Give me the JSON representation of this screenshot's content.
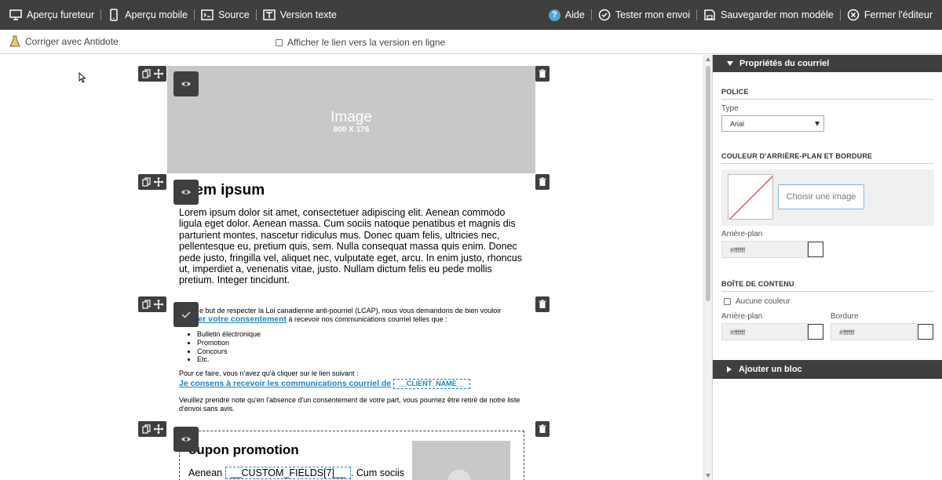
{
  "toolbar": {
    "browser_preview": "Aperçu fureteur",
    "mobile_preview": "Aperçu mobile",
    "source": "Source",
    "text_version": "Version texte",
    "help": "Aide",
    "test_send": "Tester mon envoi",
    "save_model": "Sauvegarder mon modèle",
    "close_editor": "Fermer l'éditeur"
  },
  "subbar": {
    "antidote": "Corriger avec Antidote",
    "online_link": "Afficher le lien vers la version en ligne"
  },
  "canvas": {
    "image_block": {
      "label": "Image",
      "size": "600 X 176"
    },
    "text_block": {
      "title": "rem ipsum",
      "body": "Lorem ipsum dolor sit amet, consectetuer adipiscing elit. Aenean commodo ligula eget dolor. Aenean massa. Cum sociis natoque penatibus et magnis dis parturient montes, nascetur ridiculus mus. Donec quam felis, ultricies nec, pellentesque eu, pretium quis, sem. Nulla consequat massa quis enim. Donec pede justo, fringilla vel, aliquet nec, vulputate eget, arcu. In enim justo, rhoncus ut, imperdiet a, venenatis vitae, justo. Nullam dictum felis eu pede mollis pretium. Integer tincidunt."
    },
    "consent_block": {
      "intro_before": "e but de respecter la Loi canadienne anti-pourriel (LCAP), nous vous demandons de bien vouloir",
      "confirm_link": "rmer votre consentement",
      "intro_after": " à recevoir nos communications courriel telles que :",
      "items": [
        "Bulletin électronique",
        "Promotion",
        "Concours",
        "Etc."
      ],
      "click_text": "Pour ce faire, vous n'avez qu'à cliquer sur le lien suivant :",
      "consent_link": "Je consens à recevoir les communications courriel de",
      "client_field": "__CLIENT_NAME__",
      "note": "Veuillez prendre note qu'en l'absence d'un consentement de votre part, vous pourriez être retiré de notre liste d'envoi sans avis."
    },
    "coupon_block": {
      "title": "oupon promotion",
      "line_start": "Aenean",
      "custom_field": "__CUSTOM_FIELDS[7]__",
      "line_end": ". Cum sociis"
    }
  },
  "panel": {
    "header": "Propriétés du courriel",
    "font_section": "POLICE",
    "type_label": "Type",
    "type_value": "Arial",
    "bg_section": "COULEUR D'ARRIÈRE-PLAN ET BORDURE",
    "choose_image": "Choisir une image",
    "background_label": "Arrière-plan",
    "background_value": "#ffffff",
    "content_section": "BOÎTE DE CONTENU",
    "no_color": "Aucune couleur",
    "content_bg_label": "Arrière-plan",
    "content_bg_value": "#ffffff",
    "border_label": "Bordure",
    "border_value": "#ffffff",
    "add_block": "Ajouter un bloc"
  },
  "colors": {
    "toolbar": "#3f3f3f",
    "accent": "#1a84c4",
    "help": "#4da6d8"
  }
}
